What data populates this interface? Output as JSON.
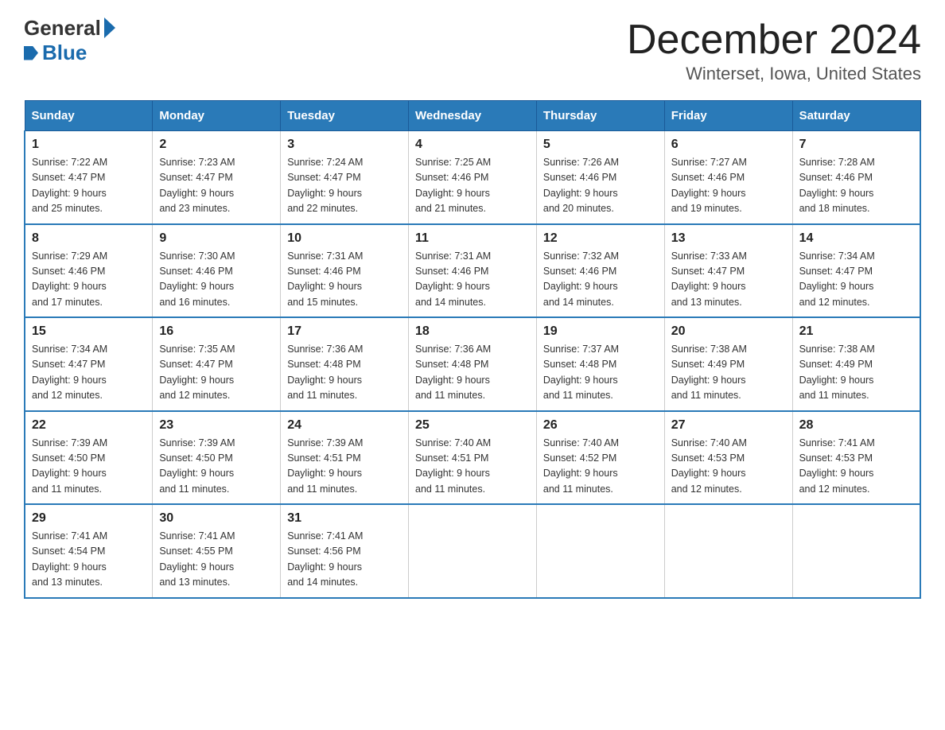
{
  "header": {
    "logo_general": "General",
    "logo_blue": "Blue",
    "title": "December 2024",
    "subtitle": "Winterset, Iowa, United States"
  },
  "days_of_week": [
    "Sunday",
    "Monday",
    "Tuesday",
    "Wednesday",
    "Thursday",
    "Friday",
    "Saturday"
  ],
  "weeks": [
    [
      {
        "day": "1",
        "sunrise": "Sunrise: 7:22 AM",
        "sunset": "Sunset: 4:47 PM",
        "daylight": "Daylight: 9 hours",
        "daylight2": "and 25 minutes."
      },
      {
        "day": "2",
        "sunrise": "Sunrise: 7:23 AM",
        "sunset": "Sunset: 4:47 PM",
        "daylight": "Daylight: 9 hours",
        "daylight2": "and 23 minutes."
      },
      {
        "day": "3",
        "sunrise": "Sunrise: 7:24 AM",
        "sunset": "Sunset: 4:47 PM",
        "daylight": "Daylight: 9 hours",
        "daylight2": "and 22 minutes."
      },
      {
        "day": "4",
        "sunrise": "Sunrise: 7:25 AM",
        "sunset": "Sunset: 4:46 PM",
        "daylight": "Daylight: 9 hours",
        "daylight2": "and 21 minutes."
      },
      {
        "day": "5",
        "sunrise": "Sunrise: 7:26 AM",
        "sunset": "Sunset: 4:46 PM",
        "daylight": "Daylight: 9 hours",
        "daylight2": "and 20 minutes."
      },
      {
        "day": "6",
        "sunrise": "Sunrise: 7:27 AM",
        "sunset": "Sunset: 4:46 PM",
        "daylight": "Daylight: 9 hours",
        "daylight2": "and 19 minutes."
      },
      {
        "day": "7",
        "sunrise": "Sunrise: 7:28 AM",
        "sunset": "Sunset: 4:46 PM",
        "daylight": "Daylight: 9 hours",
        "daylight2": "and 18 minutes."
      }
    ],
    [
      {
        "day": "8",
        "sunrise": "Sunrise: 7:29 AM",
        "sunset": "Sunset: 4:46 PM",
        "daylight": "Daylight: 9 hours",
        "daylight2": "and 17 minutes."
      },
      {
        "day": "9",
        "sunrise": "Sunrise: 7:30 AM",
        "sunset": "Sunset: 4:46 PM",
        "daylight": "Daylight: 9 hours",
        "daylight2": "and 16 minutes."
      },
      {
        "day": "10",
        "sunrise": "Sunrise: 7:31 AM",
        "sunset": "Sunset: 4:46 PM",
        "daylight": "Daylight: 9 hours",
        "daylight2": "and 15 minutes."
      },
      {
        "day": "11",
        "sunrise": "Sunrise: 7:31 AM",
        "sunset": "Sunset: 4:46 PM",
        "daylight": "Daylight: 9 hours",
        "daylight2": "and 14 minutes."
      },
      {
        "day": "12",
        "sunrise": "Sunrise: 7:32 AM",
        "sunset": "Sunset: 4:46 PM",
        "daylight": "Daylight: 9 hours",
        "daylight2": "and 14 minutes."
      },
      {
        "day": "13",
        "sunrise": "Sunrise: 7:33 AM",
        "sunset": "Sunset: 4:47 PM",
        "daylight": "Daylight: 9 hours",
        "daylight2": "and 13 minutes."
      },
      {
        "day": "14",
        "sunrise": "Sunrise: 7:34 AM",
        "sunset": "Sunset: 4:47 PM",
        "daylight": "Daylight: 9 hours",
        "daylight2": "and 12 minutes."
      }
    ],
    [
      {
        "day": "15",
        "sunrise": "Sunrise: 7:34 AM",
        "sunset": "Sunset: 4:47 PM",
        "daylight": "Daylight: 9 hours",
        "daylight2": "and 12 minutes."
      },
      {
        "day": "16",
        "sunrise": "Sunrise: 7:35 AM",
        "sunset": "Sunset: 4:47 PM",
        "daylight": "Daylight: 9 hours",
        "daylight2": "and 12 minutes."
      },
      {
        "day": "17",
        "sunrise": "Sunrise: 7:36 AM",
        "sunset": "Sunset: 4:48 PM",
        "daylight": "Daylight: 9 hours",
        "daylight2": "and 11 minutes."
      },
      {
        "day": "18",
        "sunrise": "Sunrise: 7:36 AM",
        "sunset": "Sunset: 4:48 PM",
        "daylight": "Daylight: 9 hours",
        "daylight2": "and 11 minutes."
      },
      {
        "day": "19",
        "sunrise": "Sunrise: 7:37 AM",
        "sunset": "Sunset: 4:48 PM",
        "daylight": "Daylight: 9 hours",
        "daylight2": "and 11 minutes."
      },
      {
        "day": "20",
        "sunrise": "Sunrise: 7:38 AM",
        "sunset": "Sunset: 4:49 PM",
        "daylight": "Daylight: 9 hours",
        "daylight2": "and 11 minutes."
      },
      {
        "day": "21",
        "sunrise": "Sunrise: 7:38 AM",
        "sunset": "Sunset: 4:49 PM",
        "daylight": "Daylight: 9 hours",
        "daylight2": "and 11 minutes."
      }
    ],
    [
      {
        "day": "22",
        "sunrise": "Sunrise: 7:39 AM",
        "sunset": "Sunset: 4:50 PM",
        "daylight": "Daylight: 9 hours",
        "daylight2": "and 11 minutes."
      },
      {
        "day": "23",
        "sunrise": "Sunrise: 7:39 AM",
        "sunset": "Sunset: 4:50 PM",
        "daylight": "Daylight: 9 hours",
        "daylight2": "and 11 minutes."
      },
      {
        "day": "24",
        "sunrise": "Sunrise: 7:39 AM",
        "sunset": "Sunset: 4:51 PM",
        "daylight": "Daylight: 9 hours",
        "daylight2": "and 11 minutes."
      },
      {
        "day": "25",
        "sunrise": "Sunrise: 7:40 AM",
        "sunset": "Sunset: 4:51 PM",
        "daylight": "Daylight: 9 hours",
        "daylight2": "and 11 minutes."
      },
      {
        "day": "26",
        "sunrise": "Sunrise: 7:40 AM",
        "sunset": "Sunset: 4:52 PM",
        "daylight": "Daylight: 9 hours",
        "daylight2": "and 11 minutes."
      },
      {
        "day": "27",
        "sunrise": "Sunrise: 7:40 AM",
        "sunset": "Sunset: 4:53 PM",
        "daylight": "Daylight: 9 hours",
        "daylight2": "and 12 minutes."
      },
      {
        "day": "28",
        "sunrise": "Sunrise: 7:41 AM",
        "sunset": "Sunset: 4:53 PM",
        "daylight": "Daylight: 9 hours",
        "daylight2": "and 12 minutes."
      }
    ],
    [
      {
        "day": "29",
        "sunrise": "Sunrise: 7:41 AM",
        "sunset": "Sunset: 4:54 PM",
        "daylight": "Daylight: 9 hours",
        "daylight2": "and 13 minutes."
      },
      {
        "day": "30",
        "sunrise": "Sunrise: 7:41 AM",
        "sunset": "Sunset: 4:55 PM",
        "daylight": "Daylight: 9 hours",
        "daylight2": "and 13 minutes."
      },
      {
        "day": "31",
        "sunrise": "Sunrise: 7:41 AM",
        "sunset": "Sunset: 4:56 PM",
        "daylight": "Daylight: 9 hours",
        "daylight2": "and 14 minutes."
      },
      {
        "day": "",
        "sunrise": "",
        "sunset": "",
        "daylight": "",
        "daylight2": ""
      },
      {
        "day": "",
        "sunrise": "",
        "sunset": "",
        "daylight": "",
        "daylight2": ""
      },
      {
        "day": "",
        "sunrise": "",
        "sunset": "",
        "daylight": "",
        "daylight2": ""
      },
      {
        "day": "",
        "sunrise": "",
        "sunset": "",
        "daylight": "",
        "daylight2": ""
      }
    ]
  ]
}
